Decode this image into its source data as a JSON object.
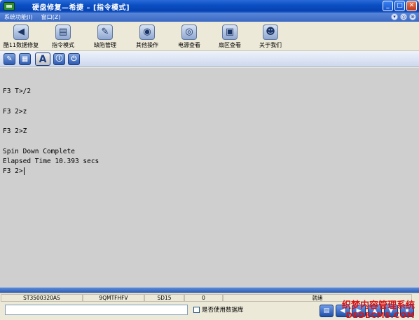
{
  "window": {
    "title": "硬盘修复—希捷 – [指令模式]"
  },
  "menu": {
    "items": [
      "系统功能(I)",
      "窗口(Z)"
    ],
    "controls": [
      "▾",
      "◎",
      "⊗"
    ]
  },
  "toolbar": {
    "buttons": [
      {
        "label": "酷11数据修复",
        "icon": "back-arrow-icon",
        "glyph": "◀"
      },
      {
        "label": "指令模式",
        "icon": "command-book-icon",
        "glyph": "▤"
      },
      {
        "label": "缺陷管理",
        "icon": "tools-icon",
        "glyph": "✎"
      },
      {
        "label": "其他操作",
        "icon": "disk-gear-icon",
        "glyph": "◉"
      },
      {
        "label": "电源查看",
        "icon": "power-disc-icon",
        "glyph": "◎"
      },
      {
        "label": "扇区查看",
        "icon": "sector-window-icon",
        "glyph": "▣"
      },
      {
        "label": "关于我们",
        "icon": "user-icon",
        "glyph": "☻"
      }
    ]
  },
  "small_toolbar": {
    "buttons": [
      {
        "icon": "edit-icon",
        "glyph": "✎"
      },
      {
        "icon": "save-icon",
        "glyph": "▦"
      },
      {
        "icon": "font-icon",
        "glyph": "A"
      },
      {
        "icon": "info-icon",
        "glyph": "ⓘ"
      },
      {
        "icon": "power-icon",
        "glyph": "⏻"
      }
    ]
  },
  "terminal": {
    "lines": [
      "F3 T>/2",
      "F3 2>z",
      "F3 2>Z",
      "Spin Down Complete",
      "Elapsed Time 10.393 secs",
      "F3 2>"
    ]
  },
  "status": {
    "cells": [
      "ST3500320AS",
      "9QMTFHFV",
      "SD15",
      "0",
      "就绪"
    ]
  },
  "bottom": {
    "checkbox_label": "是否使用数据库",
    "button_glyphs": [
      "▤",
      "◀",
      "▶",
      "▲",
      "▼",
      "⏹"
    ]
  },
  "watermark": {
    "line1": "织梦内容管理系统",
    "line2": "DEDECMS.COM"
  }
}
